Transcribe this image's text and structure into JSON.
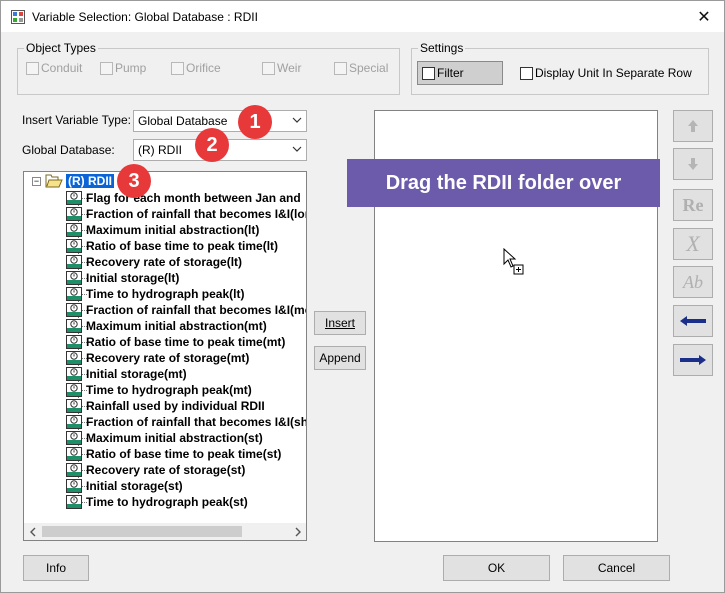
{
  "window": {
    "title": "Variable Selection: Global Database : RDII",
    "close_glyph": "✕"
  },
  "object_types": {
    "legend": "Object Types",
    "items": [
      {
        "label": "Conduit"
      },
      {
        "label": "Pump"
      },
      {
        "label": "Orifice"
      },
      {
        "label": "Weir"
      },
      {
        "label": "Special"
      }
    ]
  },
  "settings": {
    "legend": "Settings",
    "filter_label": "Filter",
    "display_unit_label": "Display Unit In Separate Row"
  },
  "insert_variable_type": {
    "label": "Insert Variable Type:",
    "value": "Global Database"
  },
  "global_database": {
    "label": "Global Database:",
    "value": "(R) RDII"
  },
  "tree": {
    "expander": "−",
    "root": "(R) RDII",
    "items": [
      "Flag for each month between Jan and",
      "Fraction of rainfall that becomes I&I(lon",
      "Maximum initial abstraction(lt)",
      "Ratio of base time to peak time(lt)",
      "Recovery rate of storage(lt)",
      "Initial storage(lt)",
      "Time to hydrograph peak(lt)",
      "Fraction of rainfall that becomes I&I(me",
      "Maximum initial abstraction(mt)",
      "Ratio of base time to peak time(mt)",
      "Recovery rate of storage(mt)",
      "Initial storage(mt)",
      "Time to hydrograph peak(mt)",
      "Rainfall used by individual RDII",
      "Fraction of rainfall that becomes I&I(sh",
      "Maximum initial abstraction(st)",
      "Ratio of base time to peak time(st)",
      "Recovery rate of storage(st)",
      "Initial storage(st)",
      "Time to hydrograph peak(st)"
    ]
  },
  "buttons": {
    "insert": "Insert",
    "append": "Append",
    "info": "Info",
    "ok": "OK",
    "cancel": "Cancel"
  },
  "side_tools": {
    "rename": "Re",
    "delete": "X",
    "abbrev": "Ab"
  },
  "annotations": {
    "badge_1": "1",
    "badge_2": "2",
    "badge_3": "3",
    "tooltip": "Drag the RDII folder over",
    "badge_color": "#e8393a",
    "tooltip_color": "#6b5baa"
  }
}
